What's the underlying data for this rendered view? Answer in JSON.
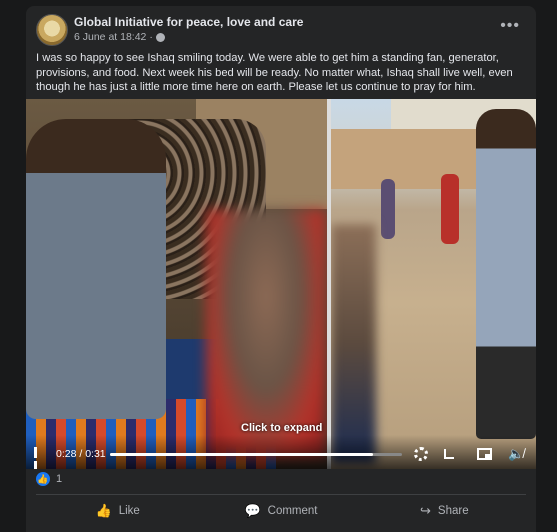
{
  "post": {
    "page_name": "Global Initiative for peace, love and care",
    "date": "6 June at 18:42",
    "meta_sep": "·",
    "text": "I was so happy to see Ishaq smiling today. We were able to get him a standing fan, generator, provisions, and food. Next week his bed will be ready. No matter what, Ishaq shall live well, even though he has just a little more time here on earth. Please let us continue to pray for him.",
    "more_icon": "more-options-icon"
  },
  "video": {
    "expand_label": "Click to expand",
    "time": "0:28 / 0:31",
    "progress": 0.9
  },
  "reactions": {
    "count": "1",
    "icon": "thumbs-up-icon"
  },
  "actions": {
    "like": "Like",
    "comment": "Comment",
    "share": "Share"
  },
  "colors": {
    "background": "#18191a",
    "card": "#242526",
    "accent": "#1877f2"
  }
}
